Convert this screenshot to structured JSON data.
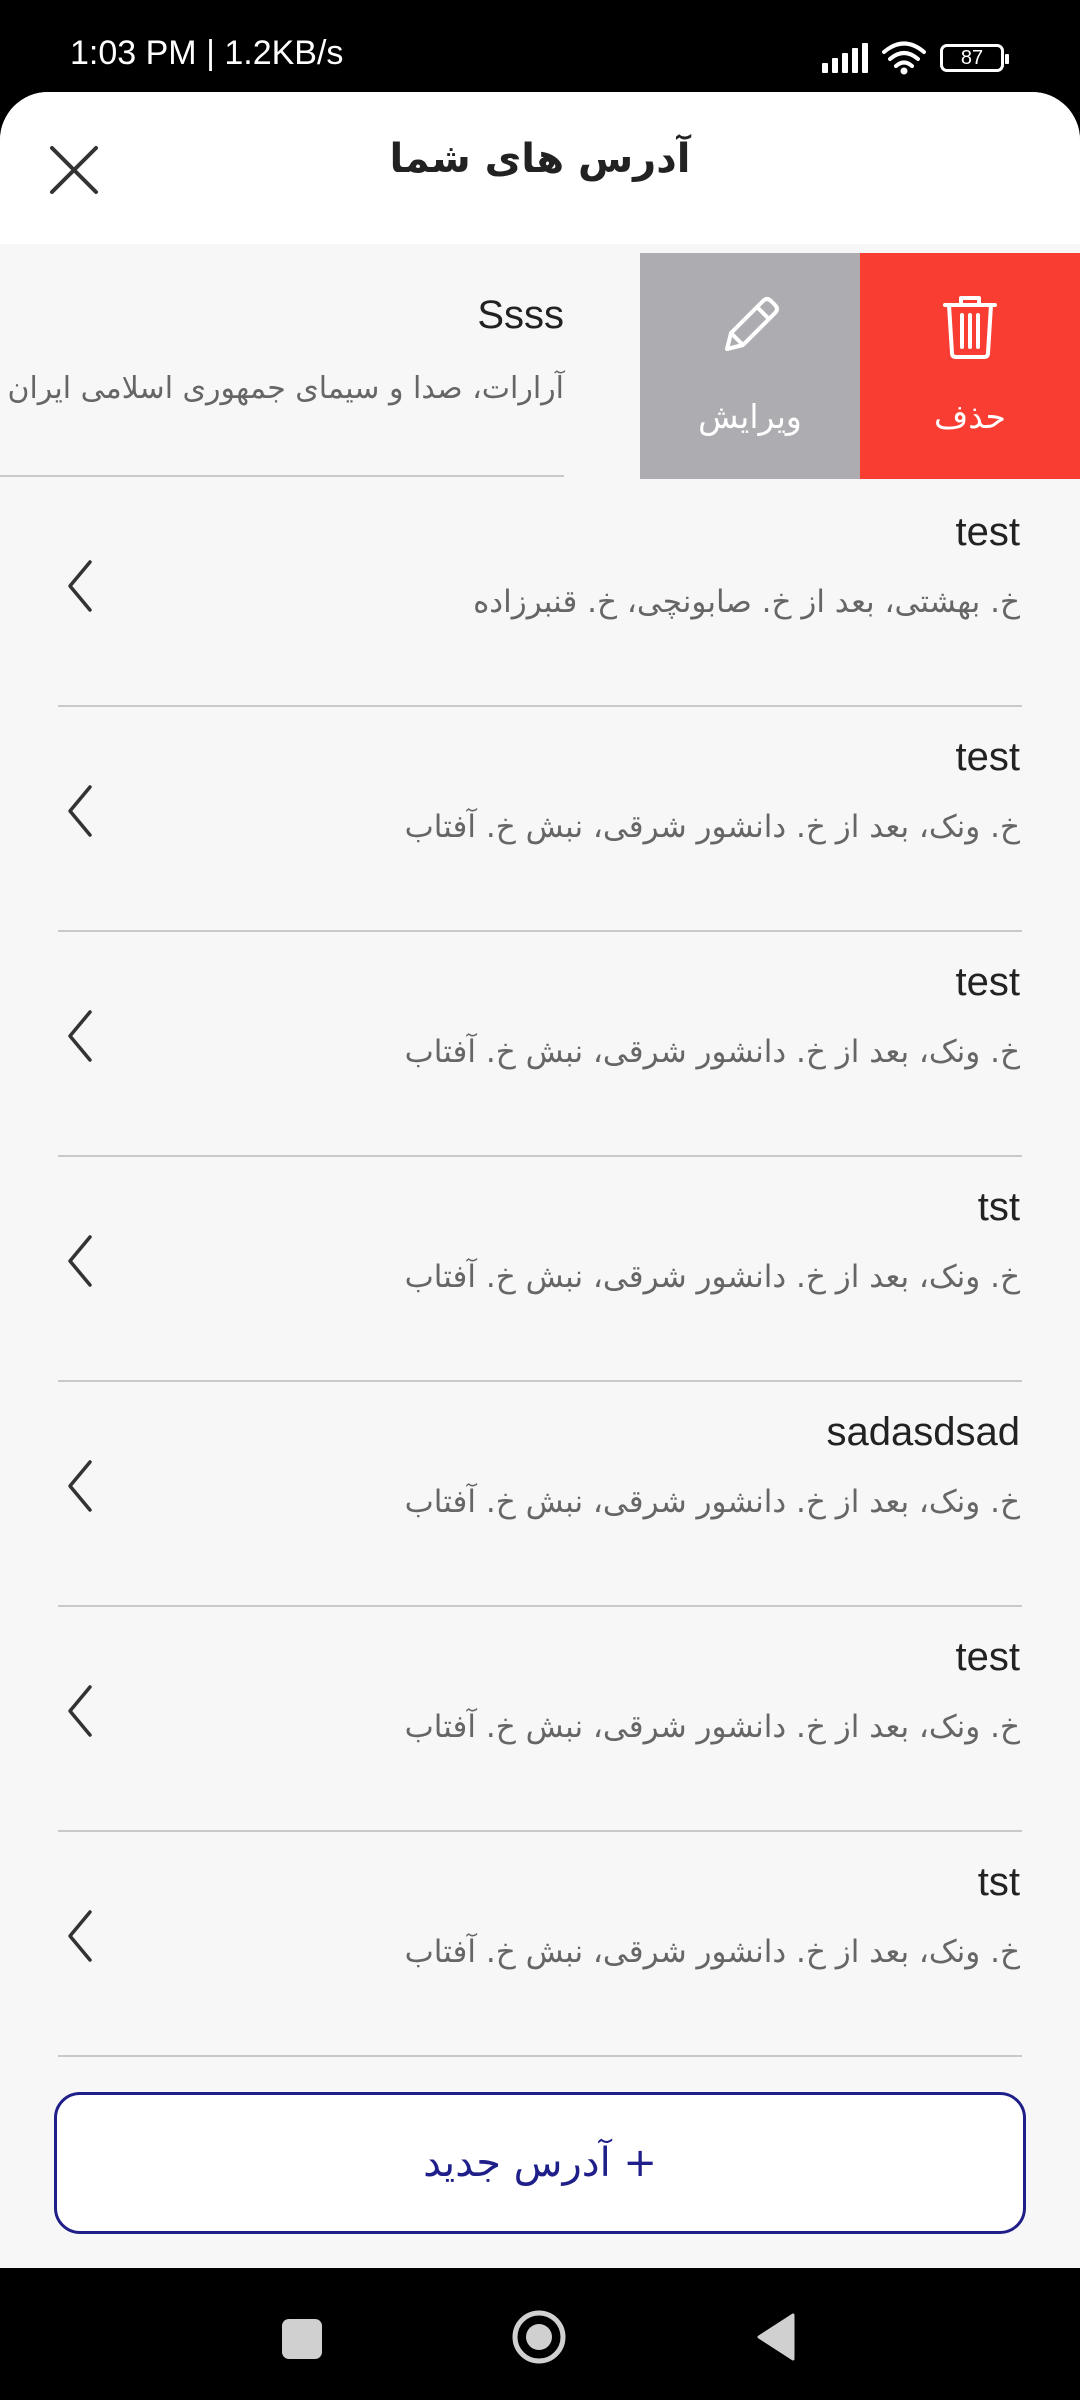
{
  "status_bar": {
    "time": "1:03 PM | 1.2KB/s",
    "battery": "87",
    "icons": [
      "signal-icon",
      "wifi-icon",
      "battery-icon"
    ]
  },
  "header": {
    "title": "آدرس های شما",
    "close_icon": "close-icon"
  },
  "swiped_item": {
    "title": "Ssss",
    "address": "آرارات، صدا و سیمای جمهوری اسلامی ایران",
    "edit_label": "ویرایش",
    "delete_label": "حذف",
    "edit_color": "#adadb1",
    "delete_color": "#fa3d32"
  },
  "addresses": [
    {
      "title": "test",
      "address": "خ. بهشتی، بعد از خ. صابونچی، خ. قنبرزاده"
    },
    {
      "title": "test",
      "address": "خ. ونک، بعد از خ. دانشور شرقی، نبش خ. آفتاب"
    },
    {
      "title": "test",
      "address": "خ. ونک، بعد از خ. دانشور شرقی، نبش خ. آفتاب"
    },
    {
      "title": "tst",
      "address": "خ. ونک، بعد از خ. دانشور شرقی، نبش خ. آفتاب"
    },
    {
      "title": "sadasdsad",
      "address": "خ. ونک، بعد از خ. دانشور شرقی، نبش خ. آفتاب"
    },
    {
      "title": "test",
      "address": "خ. ونک، بعد از خ. دانشور شرقی، نبش خ. آفتاب"
    },
    {
      "title": "tst",
      "address": "خ. ونک، بعد از خ. دانشور شرقی، نبش خ. آفتاب"
    }
  ],
  "new_address_button": "+ آدرس جدید",
  "accent_color": "#1f1f8a",
  "nav_bar": {
    "icons": [
      "recents-icon",
      "home-icon",
      "back-icon"
    ]
  }
}
